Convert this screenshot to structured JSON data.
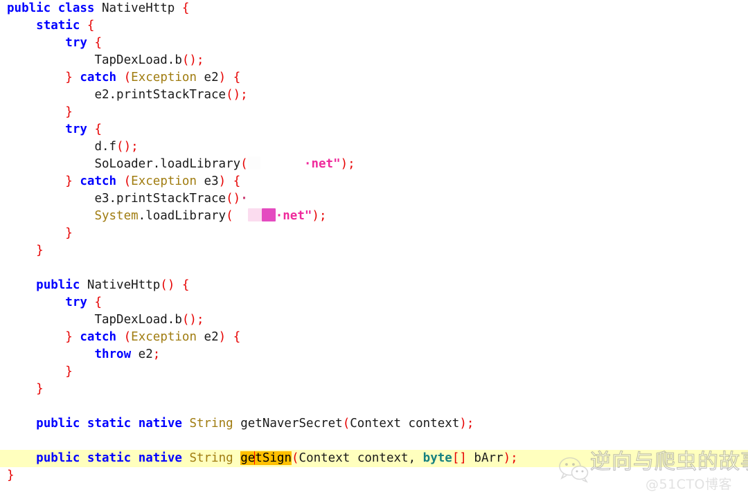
{
  "editor": {
    "language": "java",
    "colors": {
      "keyword": "#0000ff",
      "type": "#a07c10",
      "punctuation": "#e60000",
      "string": "#ef2a9c",
      "primitive": "#168080",
      "plain_text": "#1a1a1a",
      "current_line_highlight": "#ffffbe",
      "selection_highlight": "#ffc000",
      "caret": "#ff0000",
      "background": "#ffffff"
    },
    "lines": [
      {
        "n": 1,
        "indent": 0,
        "tokens": [
          {
            "t": "kw",
            "v": "public"
          },
          {
            "t": "plain",
            "v": " "
          },
          {
            "t": "kw",
            "v": "class"
          },
          {
            "t": "plain",
            "v": " NativeHttp "
          },
          {
            "t": "punct",
            "v": "{"
          }
        ]
      },
      {
        "n": 2,
        "indent": 1,
        "tokens": [
          {
            "t": "kw",
            "v": "static"
          },
          {
            "t": "plain",
            "v": " "
          },
          {
            "t": "punct",
            "v": "{"
          }
        ]
      },
      {
        "n": 3,
        "indent": 2,
        "tokens": [
          {
            "t": "kw",
            "v": "try"
          },
          {
            "t": "plain",
            "v": " "
          },
          {
            "t": "punct",
            "v": "{"
          }
        ]
      },
      {
        "n": 4,
        "indent": 3,
        "tokens": [
          {
            "t": "plain",
            "v": "TapDexLoad.b"
          },
          {
            "t": "punct",
            "v": "()"
          },
          {
            "t": "punct",
            "v": ";"
          }
        ]
      },
      {
        "n": 5,
        "indent": 2,
        "tokens": [
          {
            "t": "punct",
            "v": "}"
          },
          {
            "t": "plain",
            "v": " "
          },
          {
            "t": "kw",
            "v": "catch"
          },
          {
            "t": "plain",
            "v": " "
          },
          {
            "t": "punct",
            "v": "("
          },
          {
            "t": "type",
            "v": "Exception"
          },
          {
            "t": "plain",
            "v": " e2"
          },
          {
            "t": "punct",
            "v": ")"
          },
          {
            "t": "plain",
            "v": " "
          },
          {
            "t": "punct",
            "v": "{"
          }
        ]
      },
      {
        "n": 6,
        "indent": 3,
        "tokens": [
          {
            "t": "plain",
            "v": "e2.printStackTrace"
          },
          {
            "t": "punct",
            "v": "()"
          },
          {
            "t": "punct",
            "v": ";"
          }
        ]
      },
      {
        "n": 7,
        "indent": 2,
        "tokens": [
          {
            "t": "punct",
            "v": "}"
          }
        ]
      },
      {
        "n": 8,
        "indent": 2,
        "tokens": [
          {
            "t": "kw",
            "v": "try"
          },
          {
            "t": "plain",
            "v": " "
          },
          {
            "t": "punct",
            "v": "{"
          }
        ]
      },
      {
        "n": 9,
        "indent": 3,
        "tokens": [
          {
            "t": "plain",
            "v": "d.f"
          },
          {
            "t": "punct",
            "v": "()"
          },
          {
            "t": "punct",
            "v": ";"
          }
        ]
      },
      {
        "n": 10,
        "indent": 3,
        "tokens": [
          {
            "t": "plain",
            "v": "SoLoader.loadLibrary"
          },
          {
            "t": "punct",
            "v": "("
          },
          {
            "t": "redact-white",
            "v": "",
            "w": 18
          },
          {
            "t": "plain",
            "v": "      "
          },
          {
            "t": "str",
            "v": "·net\""
          },
          {
            "t": "punct",
            "v": ")"
          },
          {
            "t": "punct",
            "v": ";"
          }
        ]
      },
      {
        "n": 11,
        "indent": 2,
        "tokens": [
          {
            "t": "punct",
            "v": "}"
          },
          {
            "t": "plain",
            "v": " "
          },
          {
            "t": "kw",
            "v": "catch"
          },
          {
            "t": "plain",
            "v": " "
          },
          {
            "t": "punct",
            "v": "("
          },
          {
            "t": "type",
            "v": "Exception"
          },
          {
            "t": "plain",
            "v": " e3"
          },
          {
            "t": "punct",
            "v": ")"
          },
          {
            "t": "plain",
            "v": " "
          },
          {
            "t": "punct",
            "v": "{"
          }
        ]
      },
      {
        "n": 12,
        "indent": 3,
        "tokens": [
          {
            "t": "plain",
            "v": "e3.printStackTrace"
          },
          {
            "t": "punct",
            "v": "("
          },
          {
            "t": "punct",
            "v": ")"
          },
          {
            "t": "artifact",
            "v": "·"
          }
        ]
      },
      {
        "n": 13,
        "indent": 3,
        "tokens": [
          {
            "t": "type",
            "v": "System"
          },
          {
            "t": "plain",
            "v": ".loadLibrary"
          },
          {
            "t": "punct",
            "v": "("
          },
          {
            "t": "plain",
            "v": "  "
          },
          {
            "t": "redact-pinklight",
            "v": "",
            "w": 20
          },
          {
            "t": "redact-magenta",
            "v": "",
            "w": 20
          },
          {
            "t": "str",
            "v": "·net\""
          },
          {
            "t": "punct",
            "v": ")"
          },
          {
            "t": "punct",
            "v": ";"
          }
        ]
      },
      {
        "n": 14,
        "indent": 2,
        "tokens": [
          {
            "t": "punct",
            "v": "}"
          }
        ]
      },
      {
        "n": 15,
        "indent": 1,
        "tokens": [
          {
            "t": "punct",
            "v": "}"
          }
        ]
      },
      {
        "n": 16,
        "indent": 0,
        "tokens": []
      },
      {
        "n": 17,
        "indent": 1,
        "tokens": [
          {
            "t": "kw",
            "v": "public"
          },
          {
            "t": "plain",
            "v": " NativeHttp"
          },
          {
            "t": "punct",
            "v": "()"
          },
          {
            "t": "plain",
            "v": " "
          },
          {
            "t": "punct",
            "v": "{"
          }
        ]
      },
      {
        "n": 18,
        "indent": 2,
        "tokens": [
          {
            "t": "kw",
            "v": "try"
          },
          {
            "t": "plain",
            "v": " "
          },
          {
            "t": "punct",
            "v": "{"
          }
        ]
      },
      {
        "n": 19,
        "indent": 3,
        "tokens": [
          {
            "t": "plain",
            "v": "TapDexLoad.b"
          },
          {
            "t": "punct",
            "v": "()"
          },
          {
            "t": "punct",
            "v": ";"
          }
        ]
      },
      {
        "n": 20,
        "indent": 2,
        "tokens": [
          {
            "t": "punct",
            "v": "}"
          },
          {
            "t": "plain",
            "v": " "
          },
          {
            "t": "kw",
            "v": "catch"
          },
          {
            "t": "plain",
            "v": " "
          },
          {
            "t": "punct",
            "v": "("
          },
          {
            "t": "type",
            "v": "Exception"
          },
          {
            "t": "plain",
            "v": " e2"
          },
          {
            "t": "punct",
            "v": ")"
          },
          {
            "t": "plain",
            "v": " "
          },
          {
            "t": "punct",
            "v": "{"
          }
        ]
      },
      {
        "n": 21,
        "indent": 3,
        "tokens": [
          {
            "t": "kw",
            "v": "throw"
          },
          {
            "t": "plain",
            "v": " e2"
          },
          {
            "t": "punct",
            "v": ";"
          }
        ]
      },
      {
        "n": 22,
        "indent": 2,
        "tokens": [
          {
            "t": "punct",
            "v": "}"
          }
        ]
      },
      {
        "n": 23,
        "indent": 1,
        "tokens": [
          {
            "t": "punct",
            "v": "}"
          }
        ]
      },
      {
        "n": 24,
        "indent": 0,
        "tokens": []
      },
      {
        "n": 25,
        "indent": 1,
        "tokens": [
          {
            "t": "kw",
            "v": "public"
          },
          {
            "t": "plain",
            "v": " "
          },
          {
            "t": "kw",
            "v": "static"
          },
          {
            "t": "plain",
            "v": " "
          },
          {
            "t": "kw",
            "v": "native"
          },
          {
            "t": "plain",
            "v": " "
          },
          {
            "t": "type",
            "v": "String"
          },
          {
            "t": "plain",
            "v": " getNaverSecret"
          },
          {
            "t": "punct",
            "v": "("
          },
          {
            "t": "plain",
            "v": "Context context"
          },
          {
            "t": "punct",
            "v": ")"
          },
          {
            "t": "punct",
            "v": ";"
          }
        ]
      },
      {
        "n": 26,
        "indent": 0,
        "tokens": []
      },
      {
        "n": 27,
        "indent": 1,
        "highlight": true,
        "tokens": [
          {
            "t": "kw",
            "v": "public"
          },
          {
            "t": "plain",
            "v": " "
          },
          {
            "t": "kw",
            "v": "static"
          },
          {
            "t": "plain",
            "v": " "
          },
          {
            "t": "kw",
            "v": "native"
          },
          {
            "t": "plain",
            "v": " "
          },
          {
            "t": "type",
            "v": "String"
          },
          {
            "t": "plain",
            "v": " "
          },
          {
            "t": "sel",
            "v": "ge"
          },
          {
            "t": "caret",
            "v": ""
          },
          {
            "t": "sel",
            "v": "tSign"
          },
          {
            "t": "punct",
            "v": "("
          },
          {
            "t": "plain",
            "v": "Context context, "
          },
          {
            "t": "prim",
            "v": "byte"
          },
          {
            "t": "punct",
            "v": "[]"
          },
          {
            "t": "plain",
            "v": " bArr"
          },
          {
            "t": "punct",
            "v": ")"
          },
          {
            "t": "punct",
            "v": ";"
          }
        ]
      },
      {
        "n": 28,
        "indent": 0,
        "tokens": [
          {
            "t": "punct",
            "v": "}"
          }
        ]
      }
    ]
  },
  "watermark": {
    "logo": "wechat-icon",
    "title": "逆向与爬虫的故事",
    "subtitle": "@51CTO博客"
  }
}
